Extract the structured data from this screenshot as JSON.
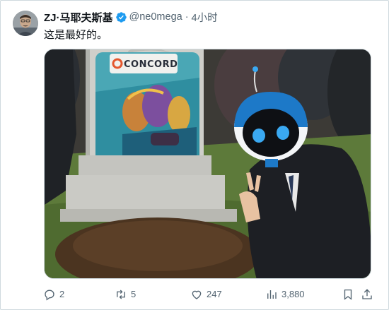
{
  "author": {
    "display_name": "ZJ·马耶夫斯基",
    "handle": "@ne0mega",
    "separator": "·",
    "time": "4小时",
    "verified": true
  },
  "tweet": {
    "text": "这是最好的。"
  },
  "media": {
    "game_logo_text": "CONCORD",
    "description_icons": [
      "tombstone",
      "robot-character",
      "grave-mound"
    ]
  },
  "actions": {
    "reply_count": "2",
    "retweet_count": "5",
    "like_count": "247",
    "view_count": "3,880"
  },
  "colors": {
    "text_primary": "#0f1419",
    "text_secondary": "#536471",
    "verified_blue": "#1d9bf0",
    "border": "#cfd9de"
  }
}
